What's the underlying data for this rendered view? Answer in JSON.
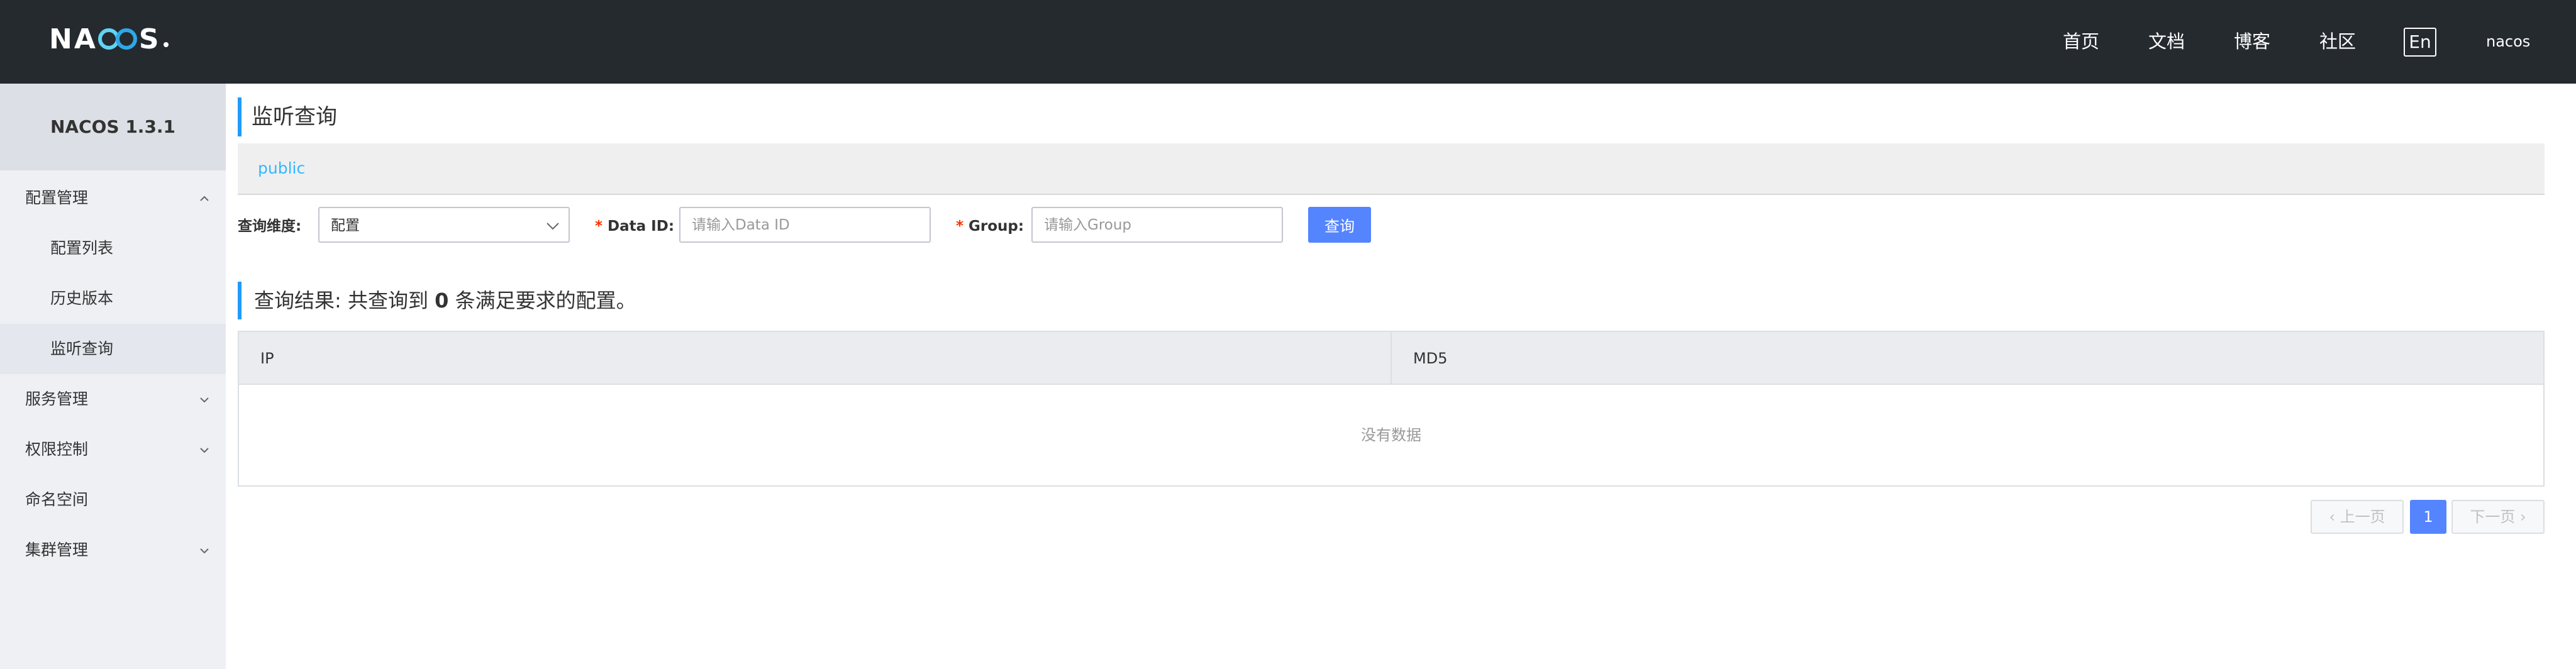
{
  "header": {
    "logo_text_left": "NA",
    "logo_text_right": "S",
    "nav": [
      "首页",
      "文档",
      "博客",
      "社区"
    ],
    "lang_button": "En",
    "username": "nacos"
  },
  "sidebar": {
    "title": "NACOS 1.3.1",
    "items": [
      {
        "label": "配置管理",
        "icon": "chevron-up-icon"
      },
      {
        "label": "配置列表"
      },
      {
        "label": "历史版本"
      },
      {
        "label": "监听查询"
      },
      {
        "label": "服务管理",
        "icon": "chevron-down-icon"
      },
      {
        "label": "权限控制",
        "icon": "chevron-down-icon"
      },
      {
        "label": "命名空间"
      },
      {
        "label": "集群管理",
        "icon": "chevron-down-icon"
      }
    ]
  },
  "main": {
    "page_title": "监听查询",
    "namespace": "public",
    "form": {
      "dimension_label": "查询维度:",
      "dimension_value": "配置",
      "data_id_label": "Data ID:",
      "data_id_placeholder": "请输入Data ID",
      "group_label": "Group:",
      "group_placeholder": "请输入Group",
      "required_mark": "*",
      "query_button": "查询"
    },
    "result": {
      "prefix": "查询结果:  共查询到 ",
      "count": "0",
      "suffix": " 条满足要求的配置。"
    },
    "table": {
      "columns": [
        "IP",
        "MD5"
      ],
      "empty_text": "没有数据"
    },
    "pagination": {
      "prev": "上一页",
      "current": "1",
      "next": "下一页"
    }
  },
  "colors": {
    "header_bg": "#252a2f",
    "accent": "#5584ff",
    "link": "#33b8ff",
    "title_bar": "#209bfa"
  }
}
